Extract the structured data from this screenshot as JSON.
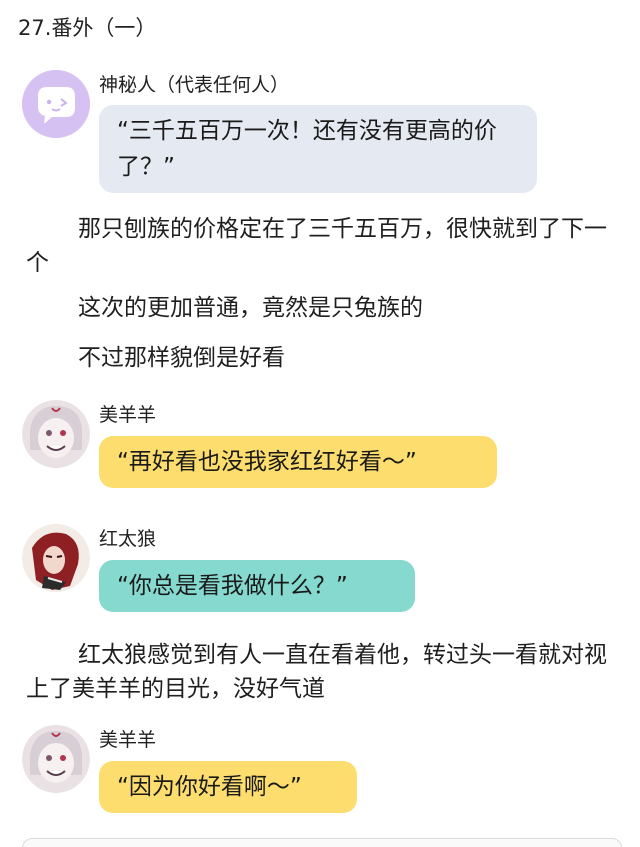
{
  "chapter_title": "27.番外（一）",
  "messages": [
    {
      "speaker": "神秘人（代表任何人）",
      "text": "“三千五百万一次！还有没有更高的价了？”",
      "bubble_color": "#e5e9f1",
      "avatar": "ghost-chat-icon"
    },
    {
      "speaker": "美羊羊",
      "text": "“再好看也没我家红红好看～”",
      "bubble_color": "#fcdd6e",
      "avatar": "character-avatar"
    },
    {
      "speaker": "红太狼",
      "text": "“你总是看我做什么？”",
      "bubble_color": "#86d9ce",
      "avatar": "character-avatar"
    },
    {
      "speaker": "美羊羊",
      "text": "“因为你好看啊～”",
      "bubble_color": "#fcdd6e",
      "avatar": "character-avatar"
    }
  ],
  "narration": [
    "那只刨族的价格定在了三千五百万，很快就到了下一个",
    "这次的更加普通，竟然是只兔族的",
    "不过那样貌倒是好看",
    "红太狼感觉到有人一直在看着他，转过头一看就对视上了美羊羊的目光，没好气道"
  ]
}
